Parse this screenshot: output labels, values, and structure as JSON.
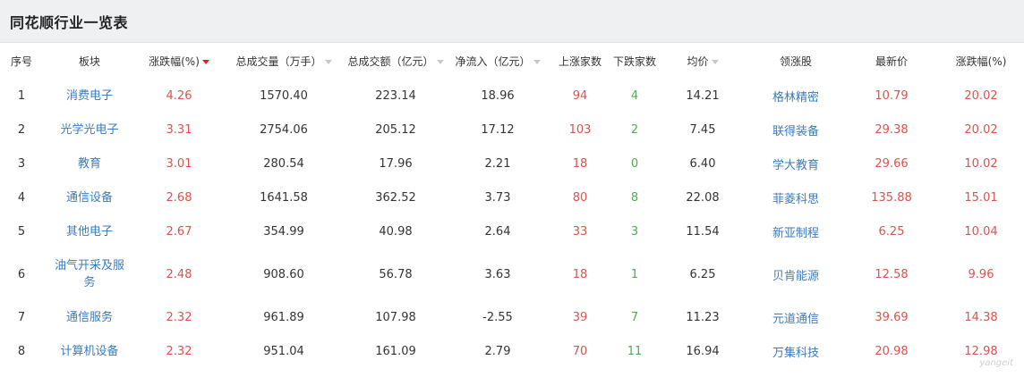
{
  "header": {
    "title": "同花顺行业一览表"
  },
  "columns": [
    "序号",
    "板块",
    "涨跌幅(%)",
    "总成交量（万手）",
    "总成交额（亿元）",
    "净流入（亿元）",
    "上涨家数",
    "下跌家数",
    "均价",
    "领涨股",
    "最新价",
    "涨跌幅(%)"
  ],
  "rows": [
    {
      "idx": "1",
      "sector": "消费电子",
      "chg": "4.26",
      "vol": "1570.40",
      "amt": "223.14",
      "flow": "18.96",
      "up": "94",
      "down": "4",
      "avg": "14.21",
      "leader": "格林精密",
      "price": "10.79",
      "lchg": "20.02"
    },
    {
      "idx": "2",
      "sector": "光学光电子",
      "chg": "3.31",
      "vol": "2754.06",
      "amt": "205.12",
      "flow": "17.12",
      "up": "103",
      "down": "2",
      "avg": "7.45",
      "leader": "联得装备",
      "price": "29.38",
      "lchg": "20.02"
    },
    {
      "idx": "3",
      "sector": "教育",
      "chg": "3.01",
      "vol": "280.54",
      "amt": "17.96",
      "flow": "2.21",
      "up": "18",
      "down": "0",
      "avg": "6.40",
      "leader": "学大教育",
      "price": "29.66",
      "lchg": "10.02"
    },
    {
      "idx": "4",
      "sector": "通信设备",
      "chg": "2.68",
      "vol": "1641.58",
      "amt": "362.52",
      "flow": "3.73",
      "up": "80",
      "down": "8",
      "avg": "22.08",
      "leader": "菲菱科思",
      "price": "135.88",
      "lchg": "15.01"
    },
    {
      "idx": "5",
      "sector": "其他电子",
      "chg": "2.67",
      "vol": "354.99",
      "amt": "40.98",
      "flow": "2.64",
      "up": "33",
      "down": "3",
      "avg": "11.54",
      "leader": "新亚制程",
      "price": "6.25",
      "lchg": "10.04"
    },
    {
      "idx": "6",
      "sector": "油气开采及服务",
      "chg": "2.48",
      "vol": "908.60",
      "amt": "56.78",
      "flow": "3.63",
      "up": "18",
      "down": "1",
      "avg": "6.25",
      "leader": "贝肯能源",
      "price": "12.58",
      "lchg": "9.96"
    },
    {
      "idx": "7",
      "sector": "通信服务",
      "chg": "2.32",
      "vol": "961.89",
      "amt": "107.98",
      "flow": "-2.55",
      "up": "39",
      "down": "7",
      "avg": "11.23",
      "leader": "元道通信",
      "price": "39.69",
      "lchg": "14.38"
    },
    {
      "idx": "8",
      "sector": "计算机设备",
      "chg": "2.32",
      "vol": "951.04",
      "amt": "161.09",
      "flow": "2.79",
      "up": "70",
      "down": "11",
      "avg": "16.94",
      "leader": "万集科技",
      "price": "20.98",
      "lchg": "12.98"
    }
  ],
  "watermark": "yangeit",
  "colors": {
    "up": "#d9534f",
    "down": "#4cae4c",
    "link": "#3b7bbf"
  }
}
